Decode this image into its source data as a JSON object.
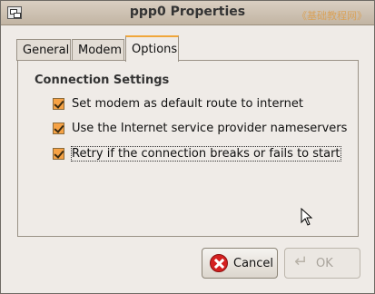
{
  "window": {
    "title": "ppp0 Properties",
    "watermark": "《基础教程网》"
  },
  "tabs": [
    {
      "label": "General"
    },
    {
      "label": "Modem"
    },
    {
      "label": "Options",
      "active": true
    }
  ],
  "panel": {
    "section_title": "Connection Settings",
    "options": [
      {
        "label": "Set modem as default route to internet",
        "checked": true
      },
      {
        "label": "Use the Internet service provider nameservers",
        "checked": true
      },
      {
        "label": "Retry if the connection breaks or fails to start",
        "checked": true,
        "focused": true
      }
    ]
  },
  "buttons": {
    "cancel_label": "Cancel",
    "ok_label": "OK",
    "ok_enabled": false
  },
  "colors": {
    "accent": "#f6a245",
    "background": "#efebe7",
    "cancel_icon": "#d42020"
  }
}
